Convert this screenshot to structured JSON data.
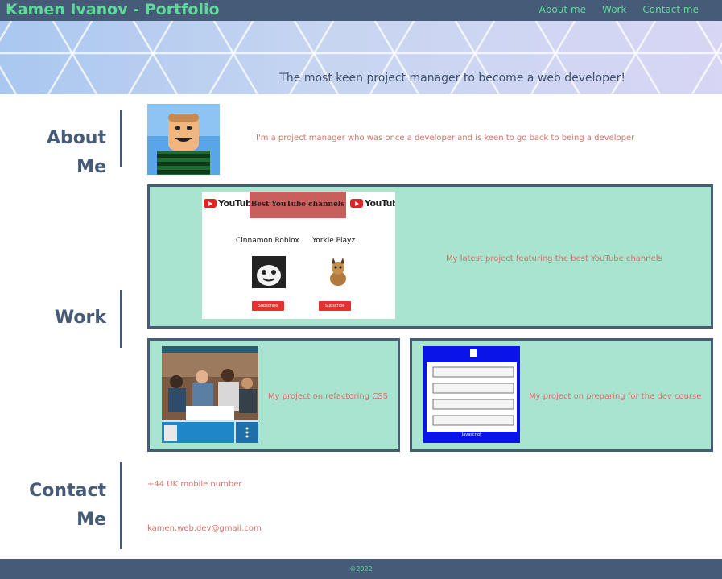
{
  "header": {
    "title": "Kamen Ivanov - Portfolio",
    "nav": [
      "About me",
      "Work",
      "Contact me"
    ],
    "tagline": "The most keen project manager to become a web developer!"
  },
  "about": {
    "heading": "About Me",
    "text": "I'm a project manager who was once a developer and is keen to go back to being a developer"
  },
  "work": {
    "heading": "Work",
    "projects": [
      {
        "description": "My latest project featuring the best YouTube channels",
        "thumb": {
          "banner": "Best YouTube channels",
          "logo_text": "YouTube",
          "channels": [
            "Cinnamon Roblox",
            "Yorkie Playz"
          ],
          "subscribe_label": "Subscribe"
        }
      },
      {
        "description": "My project on refactoring CSS"
      },
      {
        "description": "My project on preparing for the dev course",
        "thumb": {
          "footer": "Javascript"
        }
      }
    ]
  },
  "contact": {
    "heading_line1": "Contact",
    "heading_line2": "Me",
    "phone": "+44 UK mobile number",
    "email": "kamen.web.dev@gmail.com"
  },
  "footer": {
    "copyright": "©2022"
  },
  "colors": {
    "header_bg": "#465b78",
    "accent_green": "#60d99a",
    "card_bg": "#a9e4d1",
    "text_coral": "#d9706a"
  }
}
